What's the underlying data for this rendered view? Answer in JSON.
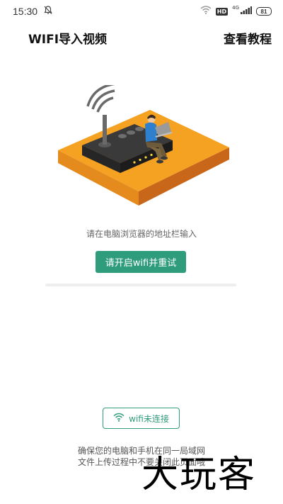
{
  "status_bar": {
    "time": "15:30",
    "network_label": "4G",
    "hd_badge": "HD",
    "battery": "81"
  },
  "header": {
    "title": "WIFI导入视频",
    "tutorial_label": "查看教程"
  },
  "main": {
    "hint": "请在电脑浏览器的地址栏输入",
    "retry_button": "请开启wifi并重试",
    "wifi_status": "wifi未连接",
    "notice_lines": [
      "确保您的电脑和手机在同一局域网",
      "文件上传过程中不要关闭此页面哦"
    ]
  },
  "watermark": "大玩客",
  "colors": {
    "accent": "#2f9c7b",
    "platform_top": "#f5a122",
    "platform_side": "#d6741a"
  }
}
